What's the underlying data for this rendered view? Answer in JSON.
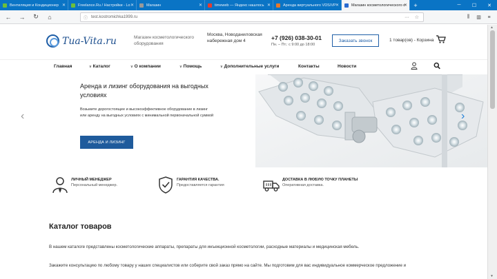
{
  "browser": {
    "tabs": [
      {
        "label": "Вентиляция и Кондиционер",
        "fav_color": "#6cbf3a",
        "active": false
      },
      {
        "label": "Freelance.Ru / Настройки - Lo",
        "fav_color": "#6cbf3a",
        "active": false
      },
      {
        "label": "Магазин",
        "fav_color": "#999999",
        "active": false
      },
      {
        "label": "timeweb — Яндекс нашлось",
        "fav_color": "#e63c2e",
        "active": false
      },
      {
        "label": "Аренда виртуального VDS/VP",
        "fav_color": "#e7782a",
        "active": false
      },
      {
        "label": "Магазин косметологического о",
        "fav_color": "#2a6bd1",
        "active": true
      }
    ],
    "url": "test.kostromichka1999.ru"
  },
  "header": {
    "logo_text": "Tua-Vita.ru",
    "tagline": "Магазин косметологического оборудования",
    "address": "Москва, Новоданиловская набережная дом 4",
    "phone": "+7 (926) 038-30-01",
    "hours": "Пн. – Пт.: с 9:00 до 18:00",
    "call_button": "Заказать звонок",
    "cart_text": "1 товар(ов) - Корзина"
  },
  "menu": [
    {
      "label": "Главная",
      "dropdown": false
    },
    {
      "label": "Каталог",
      "dropdown": true
    },
    {
      "label": "О компании",
      "dropdown": true
    },
    {
      "label": "Помощь",
      "dropdown": true
    },
    {
      "label": "Дополнительные услуги",
      "dropdown": true
    },
    {
      "label": "Контакты",
      "dropdown": false
    },
    {
      "label": "Новости",
      "dropdown": false
    }
  ],
  "hero": {
    "title": "Аренда и лизинг оборудования на выгодных условиях",
    "description": "Возьмите дорогостоящее и высокоэффективное оборудование в лизинг или аренду на выгодных условиях с минимальной первоначальной суммой",
    "button": "АРЕНДА И ЛИЗИНГ"
  },
  "features": [
    {
      "title": "ЛИЧНЫЙ МЕНЕДЖЕР",
      "desc": "Персональный менеджер.",
      "icon": "manager-icon"
    },
    {
      "title": "ГАРАНТИЯ КАЧЕСТВА.",
      "desc": "Предоставляется гарантия",
      "icon": "shield-check-icon"
    },
    {
      "title": "ДОСТАВКА В ЛЮБУЮ ТОЧКУ ПЛАНЕТЫ",
      "desc": "Оперативная доставка.",
      "icon": "delivery-truck-icon"
    }
  ],
  "catalog": {
    "title": "Каталог товаров",
    "p1": "В нашем каталоге представлены косметологические аппараты, препараты для инъекционной косметологии, расходные материалы и медицинская мебель.",
    "p2": "Закажите консультацию по любому товару у наших специалистов или соберите свой заказ прямо на сайте. Мы подготовим для вас индивидуальное коммерческое предложение и"
  },
  "colors": {
    "brand_blue": "#1f5b9c",
    "browser_blue": "#0a74c5",
    "slider_accent": "#1e7fd8"
  }
}
